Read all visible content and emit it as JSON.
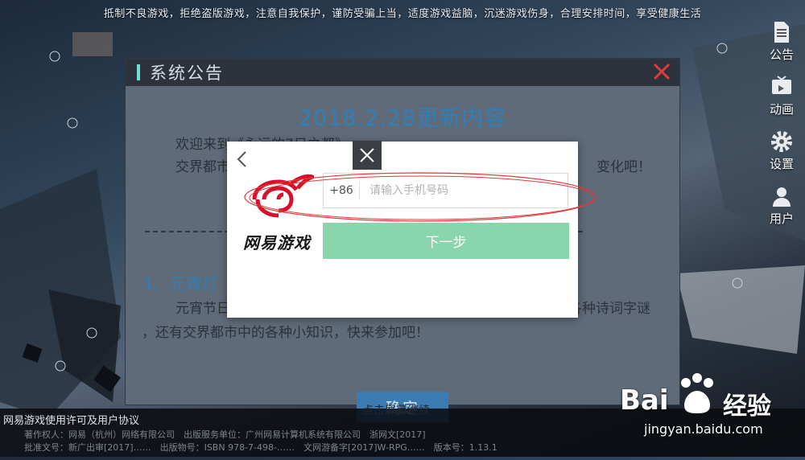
{
  "top_notice": "抵制不良游戏，拒绝盗版游戏，注意自我保护，谨防受骗上当，适度游戏益脑，沉迷游戏伤身，合理安排时间，享受健康生活",
  "side_menu": [
    {
      "label": "公告",
      "icon": "document-icon"
    },
    {
      "label": "动画",
      "icon": "tv-icon"
    },
    {
      "label": "设置",
      "icon": "gear-icon"
    },
    {
      "label": "用户",
      "icon": "user-icon"
    }
  ],
  "notice": {
    "title": "系统公告",
    "heading": "2018.2.28更新内容",
    "line1": "欢迎来到《永远的7日之都》~",
    "line2a": "交界都市",
    "line2b": "变化吧！",
    "section_title": "1、元宵灯",
    "line3a": "元宵节日",
    "line3b": "各种诗词字谜",
    "line4": "，还有交界都市中的各种小知识，快来参加吧！",
    "confirm_label": "确定"
  },
  "login_modal": {
    "brand_text": "网易游戏",
    "country_code": "+86",
    "phone_placeholder": "请输入手机号码",
    "next_label": "下一步"
  },
  "bottom": {
    "license_link": "网易游戏使用许可及用户协议",
    "tap_hint": "点击屏幕继续",
    "footer_line1": "著作权人：网易（杭州）网络有限公司　出版服务单位：广州网易计算机系统有限公司　浙网文[2017]",
    "footer_line2": "批准文号：新广出审[2017]……　出版物号：ISBN 978-7-498-……　文网游备字[2017]W-RPG……　版本号：1.13.1"
  },
  "watermark": {
    "brand": "Bai",
    "brand_suffix": "经验",
    "url": "jingyan.baidu.com"
  },
  "colors": {
    "accent_green": "#8ad6ac",
    "netease_red": "#d8102c",
    "annotation_red": "#e03a3a",
    "notice_blue": "#2f7fb8"
  }
}
